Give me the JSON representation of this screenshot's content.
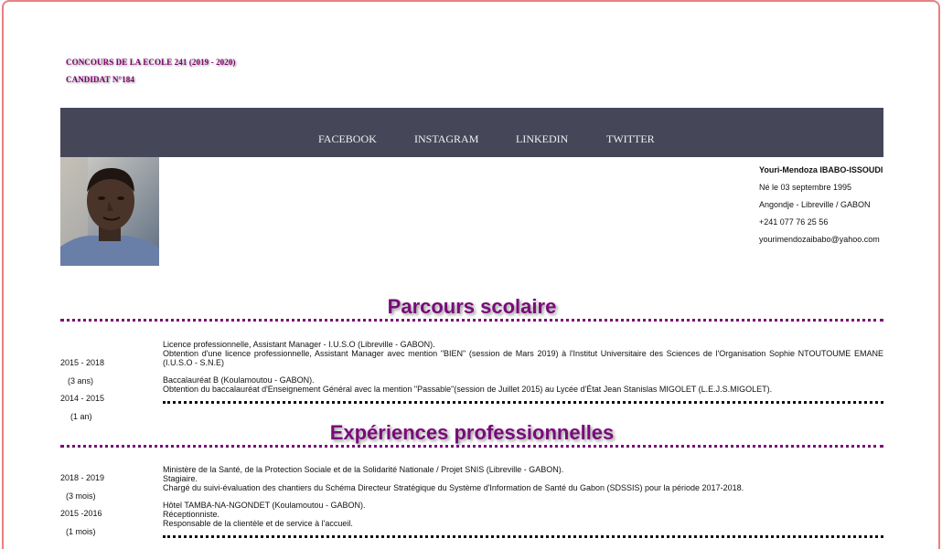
{
  "header": {
    "contest": "CONCOURS DE LA ECOLE 241 (2019 - 2020)",
    "candidate": "CANDIDAT N°184"
  },
  "nav": {
    "items": [
      "FACEBOOK",
      "INSTAGRAM",
      "LINKEDIN",
      "TWITTER"
    ]
  },
  "profile": {
    "name": "Youri-Mendoza IBABO-ISSOUDI",
    "birth": "Né le 03 septembre 1995",
    "address": "Angondje - Libreville / GABON",
    "phone": "+241 077 76 25 56",
    "email": "yourimendozaibabo@yahoo.com"
  },
  "education": {
    "title": "Parcours scolaire",
    "entries": [
      {
        "years": "2015 - 2018",
        "duration": "(3 ans)",
        "line1": "Licence professionnelle, Assistant Manager - I.U.S.O (Libreville - GABON).",
        "line2": "Obtention d'une licence professionnelle, Assistant Manager avec mention \"BIEN\" (session de Mars 2019) à l'Institut Universitaire des Sciences de l'Organisation Sophie NTOUTOUME EMANE (I.U.S.O - S.N.E)"
      },
      {
        "years": "2014 - 2015",
        "duration": "(1 an)",
        "line1": "Baccalauréat B (Koulamoutou - GABON).",
        "line2": "Obtention du baccalauréat d'Enseignement Général avec la mention \"Passable\"(session de Juillet 2015) au Lycée d'État Jean Stanislas MIGOLET (L.E.J.S.MIGOLET)."
      }
    ]
  },
  "experience": {
    "title": "Expériences professionnelles",
    "entries": [
      {
        "years": "2018 - 2019",
        "duration": "(3 mois)",
        "line1": "Ministère de la Santé, de la Protection Sociale et de la Solidarité Nationale / Projet SNIS (Libreville - GABON).",
        "line2": "Stagiaire.",
        "line3": "Chargé du suivi-évaluation des chantiers du Schéma Directeur Stratégique du Système d'Information de Santé du Gabon (SDSSIS) pour la période 2017-2018."
      },
      {
        "years": "2015 -2016",
        "duration": "(1 mois)",
        "line1": "Hôtel TAMBA-NA-NGONDET (Koulamoutou - GABON).",
        "line2": "Réceptionniste.",
        "line3": "Responsable de la clientèle et de service à l'accueil."
      }
    ]
  }
}
